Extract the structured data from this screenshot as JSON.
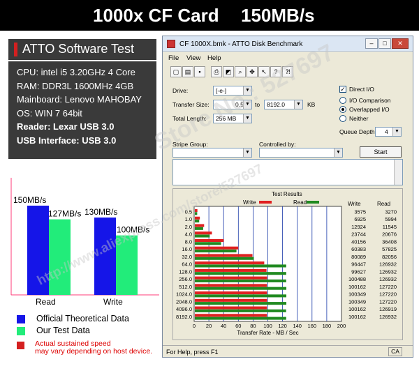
{
  "banner": {
    "product": "1000x CF Card",
    "speed": "150MB/s"
  },
  "left_panel": {
    "heading": "ATTO Software Test",
    "specs": [
      "CPU:  intel i5 3.20GHz 4 Core",
      "RAM:  DDR3L 1600MHz 4GB",
      "Mainboard:  Lenovo MAHOBAY",
      "OS:  WIN 7 64bit",
      "Reader:  Lexar USB 3.0",
      "USB Interface:  USB 3.0"
    ]
  },
  "chart_data": {
    "type": "bar",
    "categories": [
      "Read",
      "Write"
    ],
    "series": [
      {
        "name": "Official Theoretical  Data",
        "values": [
          150,
          130
        ],
        "labels": [
          "150MB/s",
          "130MB/s"
        ],
        "color": "#1515e8"
      },
      {
        "name": "Our Test Data",
        "values": [
          127,
          100
        ],
        "labels": [
          "127MB/s",
          "100MB/s"
        ],
        "color": "#22ec7a"
      }
    ],
    "ylim": [
      0,
      170
    ]
  },
  "legend": {
    "official": "Official Theoretical  Data",
    "test": "Our Test Data",
    "note": "Actual sustained speed\nmay vary depending on host device."
  },
  "atto": {
    "title": "CF 1000X.bmk - ATTO Disk Benchmark",
    "menu": [
      "File",
      "View",
      "Help"
    ],
    "drive_label": "Drive:",
    "drive_value": "[-e-]",
    "transfer_label": "Transfer Size:",
    "transfer_from": "0.5",
    "to_label": "to",
    "transfer_to": "8192.0",
    "kb_label": "KB",
    "total_label": "Total Length:",
    "total_value": "256 MB",
    "direct_io": "Direct I/O",
    "io_comparison": "I/O Comparison",
    "overlapped_io": "Overlapped I/O",
    "neither": "Neither",
    "queue_label": "Queue Depth:",
    "queue_value": "4",
    "stripe_label": "Stripe Group:",
    "controlled_label": "Controlled by:",
    "start_label": "Start",
    "results_title": "Test Results",
    "write_legend": "Write",
    "read_legend": "Read",
    "col_write": "Write",
    "col_read": "Read",
    "x_axis_label": "Transfer Rate - MB / Sec",
    "x_ticks": [
      "0",
      "20",
      "40",
      "60",
      "80",
      "100",
      "120",
      "140",
      "160",
      "180",
      "200"
    ],
    "status": "For Help, press F1",
    "caps": "CA",
    "write_color": "#e02020",
    "read_color": "#208a20",
    "rows": [
      {
        "size": "0.5",
        "write": "3575",
        "read": "3270",
        "w": 3.5,
        "r": 3.2
      },
      {
        "size": "1.0",
        "write": "6925",
        "read": "5994",
        "w": 6.8,
        "r": 5.9
      },
      {
        "size": "2.0",
        "write": "12924",
        "read": "11545",
        "w": 12.6,
        "r": 11.3
      },
      {
        "size": "4.0",
        "write": "23744",
        "read": "20676",
        "w": 23.2,
        "r": 20.2
      },
      {
        "size": "8.0",
        "write": "40156",
        "read": "36408",
        "w": 39.2,
        "r": 35.6
      },
      {
        "size": "16.0",
        "write": "60383",
        "read": "57825",
        "w": 59.0,
        "r": 56.5
      },
      {
        "size": "32.0",
        "write": "80089",
        "read": "82056",
        "w": 78.2,
        "r": 80.1
      },
      {
        "size": "64.0",
        "write": "96447",
        "read": "126932",
        "w": 94.2,
        "r": 124.0
      },
      {
        "size": "128.0",
        "write": "99627",
        "read": "126932",
        "w": 97.3,
        "r": 124.0
      },
      {
        "size": "256.0",
        "write": "100488",
        "read": "126932",
        "w": 98.1,
        "r": 124.0
      },
      {
        "size": "512.0",
        "write": "100162",
        "read": "127220",
        "w": 97.8,
        "r": 124.2
      },
      {
        "size": "1024.0",
        "write": "100349",
        "read": "127220",
        "w": 98.0,
        "r": 124.2
      },
      {
        "size": "2048.0",
        "write": "100349",
        "read": "127220",
        "w": 98.0,
        "r": 124.2
      },
      {
        "size": "4096.0",
        "write": "100162",
        "read": "126919",
        "w": 97.8,
        "r": 123.9
      },
      {
        "size": "8192.0",
        "write": "100162",
        "read": "126932",
        "w": 97.8,
        "r": 124.0
      }
    ]
  },
  "watermarks": [
    "Store No.: 527697",
    "http://www.aliexpress.com/store/527697"
  ]
}
